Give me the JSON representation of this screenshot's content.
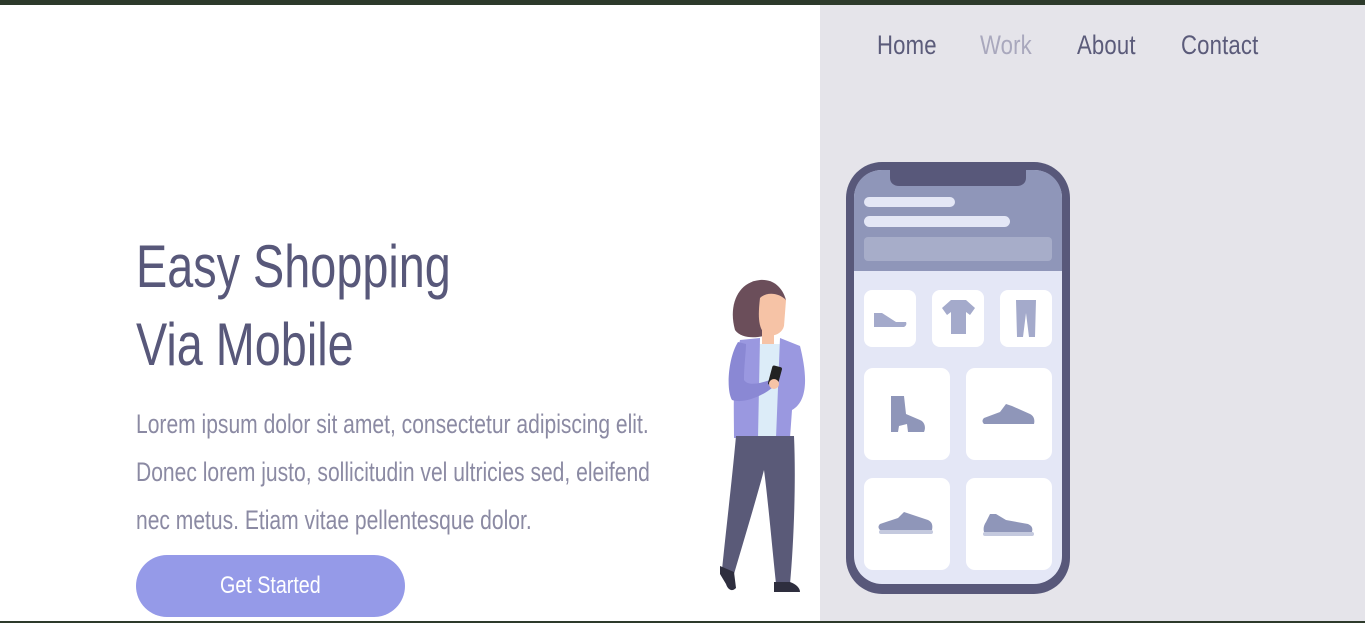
{
  "nav": {
    "items": [
      {
        "label": "Home",
        "active": false
      },
      {
        "label": "Work",
        "active": true
      },
      {
        "label": "About",
        "active": false
      },
      {
        "label": "Contact",
        "active": false
      }
    ]
  },
  "hero": {
    "title_line1": "Easy Shopping",
    "title_line2": "Via Mobile",
    "description": "Lorem ipsum dolor sit amet, consectetur adipiscing elit. Donec lorem justo, sollicitudin vel ultricies sed, eleifend nec metus. Etiam vitae pellentesque dolor.",
    "cta_label": "Get Started"
  },
  "colors": {
    "title": "#58587a",
    "body_text": "#8b8aa3",
    "button": "#959ae8",
    "panel": "#e5e4ea",
    "phone_frame": "#58587a",
    "top_bar": "#2d3a2b"
  },
  "illustration": {
    "icons": [
      "flat-shoe-icon",
      "tshirt-icon",
      "pants-icon",
      "boot-icon",
      "sneaker-icon",
      "sneaker-icon",
      "sneaker-icon"
    ]
  }
}
